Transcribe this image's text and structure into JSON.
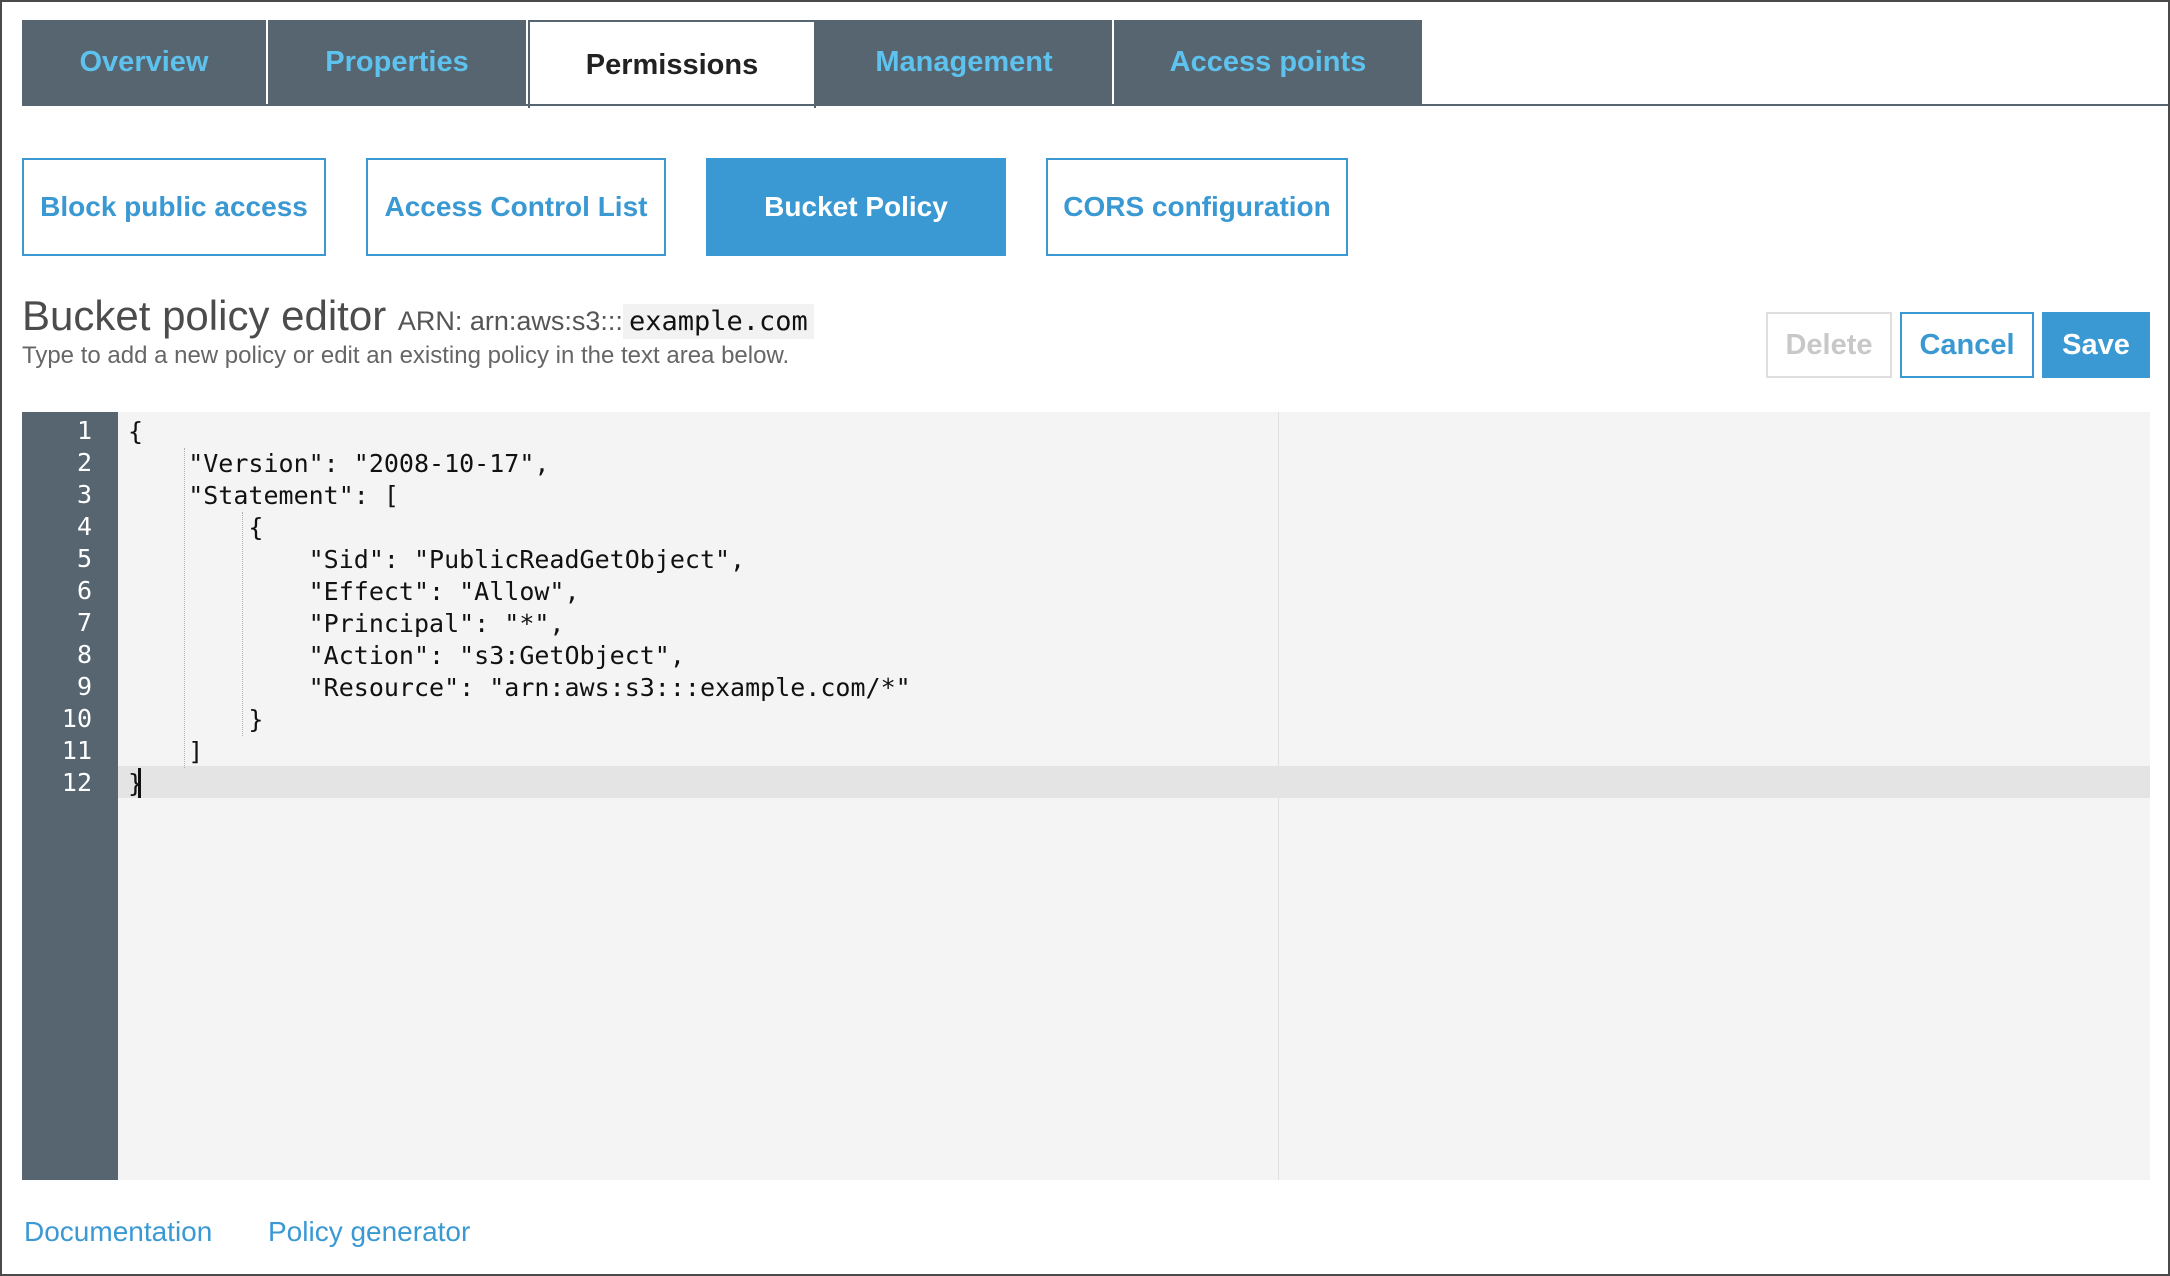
{
  "tabs": [
    {
      "label": "Overview"
    },
    {
      "label": "Properties"
    },
    {
      "label": "Permissions"
    },
    {
      "label": "Management"
    },
    {
      "label": "Access points"
    }
  ],
  "subnav": [
    {
      "label": "Block public access"
    },
    {
      "label": "Access Control List"
    },
    {
      "label": "Bucket Policy"
    },
    {
      "label": "CORS configuration"
    }
  ],
  "editor_header": {
    "title": "Bucket policy editor",
    "arn_prefix": "ARN: arn:aws:s3:::",
    "arn_bucket": "example.com",
    "subtitle": "Type to add a new policy or edit an existing policy in the text area below."
  },
  "actions": {
    "delete_label": "Delete",
    "cancel_label": "Cancel",
    "save_label": "Save"
  },
  "code": {
    "line_numbers": [
      "1",
      "2",
      "3",
      "4",
      "5",
      "6",
      "7",
      "8",
      "9",
      "10",
      "11",
      "12"
    ],
    "lines": [
      "{",
      "    \"Version\": \"2008-10-17\",",
      "    \"Statement\": [",
      "        {",
      "            \"Sid\": \"PublicReadGetObject\",",
      "            \"Effect\": \"Allow\",",
      "            \"Principal\": \"*\",",
      "            \"Action\": \"s3:GetObject\",",
      "            \"Resource\": \"arn:aws:s3:::example.com/*\"",
      "        }",
      "    ]",
      "}"
    ]
  },
  "footer": {
    "documentation_label": "Documentation",
    "policy_generator_label": "Policy generator"
  },
  "colors": {
    "accent": "#3a99d3",
    "tab_background": "#56656f",
    "tab_text": "#5ec2ef"
  }
}
